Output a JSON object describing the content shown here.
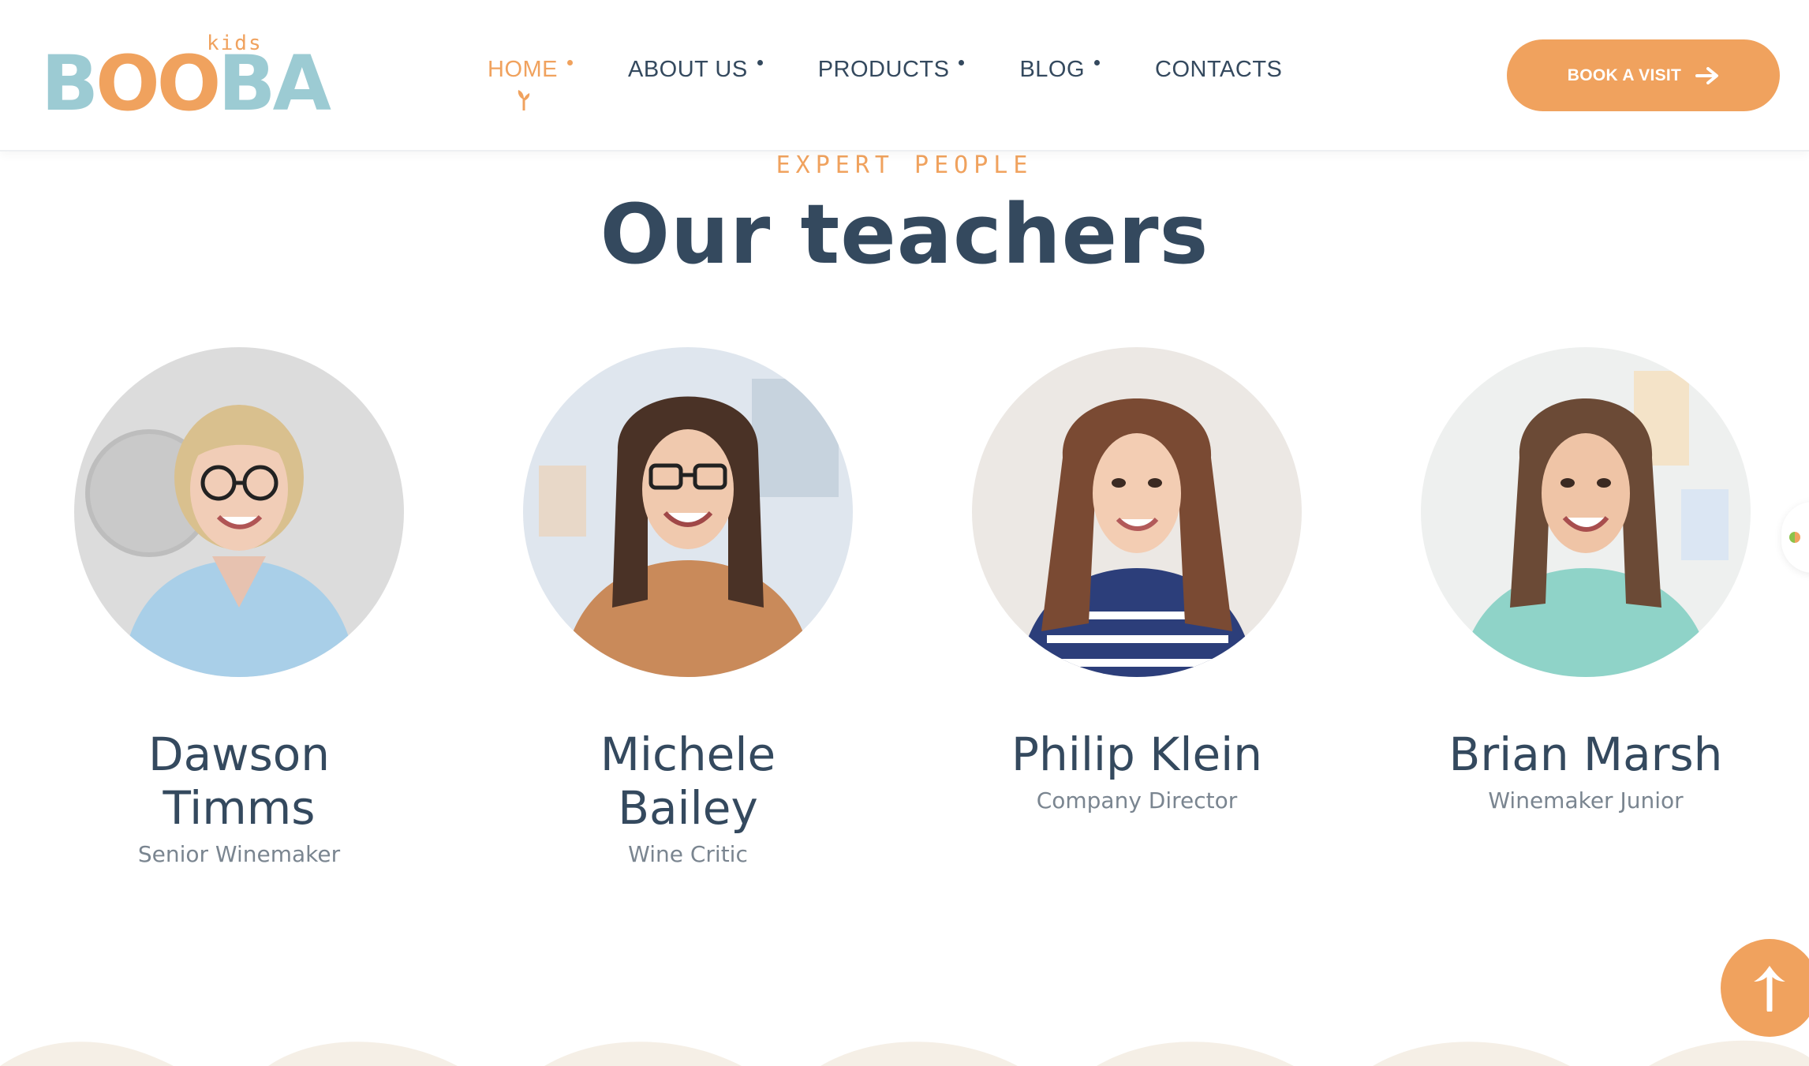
{
  "logo": {
    "small": "kids",
    "word_parts": [
      "B",
      "OO",
      "BA"
    ]
  },
  "nav": {
    "items": [
      {
        "label": "HOME",
        "active": true
      },
      {
        "label": "ABOUT US",
        "active": false
      },
      {
        "label": "PRODUCTS",
        "active": false
      },
      {
        "label": "BLOG",
        "active": false
      },
      {
        "label": "CONTACTS",
        "active": false
      }
    ],
    "cta_label": "BOOK A VISIT",
    "cta_icon": "arrow-right-icon"
  },
  "section": {
    "eyebrow": "EXPERT PEOPLE",
    "title": "Our teachers"
  },
  "teachers": [
    {
      "name_line1": "Dawson",
      "name_line2": "Timms",
      "role": "Senior Winemaker",
      "hair": "#d9c08e",
      "shirt": "#a9cfe8",
      "bg": "#dcdcdc",
      "glasses": true
    },
    {
      "name_line1": "Michele",
      "name_line2": "Bailey",
      "role": "Wine Critic",
      "hair": "#4a3226",
      "shirt": "#c98a5a",
      "bg": "#dfe6ee",
      "glasses": true
    },
    {
      "name_line1": "Philip Klein",
      "name_line2": "",
      "role": "Company Director",
      "hair": "#7a4a33",
      "shirt": "#2c3e7a",
      "bg": "#ece8e4",
      "glasses": false
    },
    {
      "name_line1": "Brian Marsh",
      "name_line2": "",
      "role": "Winemaker Junior",
      "hair": "#6b4a36",
      "shirt": "#8fd3c8",
      "bg": "#eef0ef",
      "glasses": false
    }
  ],
  "colors": {
    "accent": "#f0a25e",
    "heading": "#34495e",
    "muted": "#7a8590",
    "wave": "#f5efe6"
  },
  "icons": {
    "scroll_top": "arrow-up-icon",
    "active_marker": "sprout-icon"
  }
}
